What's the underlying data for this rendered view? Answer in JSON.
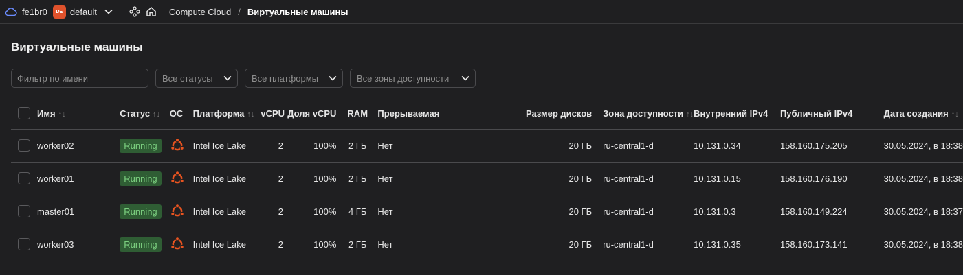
{
  "topbar": {
    "cloud_name": "fe1br0",
    "folder_badge": "DE",
    "folder_name": "default",
    "breadcrumb": [
      "Compute Cloud",
      "/",
      "Виртуальные машины"
    ]
  },
  "page_title": "Виртуальные машины",
  "filters": {
    "name_placeholder": "Фильтр по имени",
    "status": "Все статусы",
    "platform": "Все платформы",
    "zone": "Все зоны доступности"
  },
  "table": {
    "columns": [
      "Имя",
      "Статус",
      "ОС",
      "Платформа",
      "vCPU",
      "Доля vCPU",
      "RAM",
      "Прерываемая",
      "Размер дисков",
      "Зона доступности",
      "Внутренний IPv4",
      "Публичный IPv4",
      "Дата создания"
    ],
    "rows": [
      {
        "name": "worker02",
        "status": "Running",
        "os": "ubuntu-icon",
        "platform": "Intel Ice Lake",
        "vcpu": "2",
        "vcpu_share": "100%",
        "ram": "2 ГБ",
        "preemptible": "Нет",
        "disk": "20 ГБ",
        "zone": "ru-central1-d",
        "internal_ip": "10.131.0.34",
        "public_ip": "158.160.175.205",
        "created": "30.05.2024, в 18:38"
      },
      {
        "name": "worker01",
        "status": "Running",
        "os": "ubuntu-icon",
        "platform": "Intel Ice Lake",
        "vcpu": "2",
        "vcpu_share": "100%",
        "ram": "2 ГБ",
        "preemptible": "Нет",
        "disk": "20 ГБ",
        "zone": "ru-central1-d",
        "internal_ip": "10.131.0.15",
        "public_ip": "158.160.176.190",
        "created": "30.05.2024, в 18:38"
      },
      {
        "name": "master01",
        "status": "Running",
        "os": "ubuntu-icon",
        "platform": "Intel Ice Lake",
        "vcpu": "2",
        "vcpu_share": "100%",
        "ram": "4 ГБ",
        "preemptible": "Нет",
        "disk": "20 ГБ",
        "zone": "ru-central1-d",
        "internal_ip": "10.131.0.3",
        "public_ip": "158.160.149.224",
        "created": "30.05.2024, в 18:37"
      },
      {
        "name": "worker03",
        "status": "Running",
        "os": "ubuntu-icon",
        "platform": "Intel Ice Lake",
        "vcpu": "2",
        "vcpu_share": "100%",
        "ram": "2 ГБ",
        "preemptible": "Нет",
        "disk": "20 ГБ",
        "zone": "ru-central1-d",
        "internal_ip": "10.131.0.35",
        "public_ip": "158.160.173.141",
        "created": "30.05.2024, в 18:38"
      }
    ]
  },
  "colors": {
    "background": "#1f1f21",
    "running_bg": "#2f5d34",
    "running_text": "#7bcf7f",
    "ubuntu": "#e95420",
    "folder_badge": "#e0522c"
  }
}
